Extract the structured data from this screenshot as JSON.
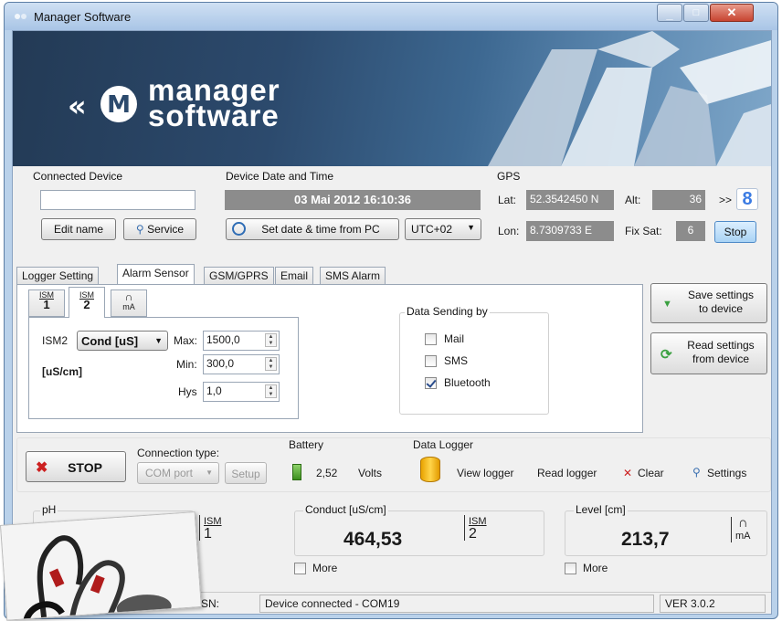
{
  "window": {
    "title": "Manager Software"
  },
  "banner": {
    "logo_line1": "manager",
    "logo_line2": "software"
  },
  "connected_device": {
    "label": "Connected Device",
    "name_value": "",
    "edit_name": "Edit name",
    "service": "Service"
  },
  "device_time": {
    "label": "Device Date and Time",
    "value": "03 Mai 2012   16:10:36",
    "set_button": "Set date & time from PC",
    "timezone": "UTC+02"
  },
  "gps": {
    "label": "GPS",
    "lat_label": "Lat:",
    "lat": "52.3542450 N",
    "alt_label": "Alt:",
    "alt": "36",
    "lon_label": "Lon:",
    "lon": "8.7309733 E",
    "fixsat_label": "Fix Sat:",
    "fixsat": "6",
    "more": ">>",
    "stop": "Stop"
  },
  "tabs": [
    "Logger Setting",
    "Alarm Sensor",
    "GSM/GPRS",
    "Email",
    "SMS Alarm"
  ],
  "subtabs": [
    {
      "top": "ISM",
      "num": "1"
    },
    {
      "top": "ISM",
      "num": "2"
    },
    {
      "top": "∩",
      "num": "mA"
    }
  ],
  "alarm": {
    "sensor_label": "ISM2",
    "sensor_select": "Cond [uS]",
    "unit": "[uS/cm]",
    "max_label": "Max:",
    "max": "1500,0",
    "min_label": "Min:",
    "min": "300,0",
    "hys_label": "Hys",
    "hys": "1,0"
  },
  "data_sending": {
    "label": "Data Sending by",
    "options": [
      {
        "label": "Mail",
        "checked": false
      },
      {
        "label": "SMS",
        "checked": false
      },
      {
        "label": "Bluetooth",
        "checked": true
      }
    ]
  },
  "side_buttons": {
    "save": "Save settings\nto device",
    "read": "Read settings\nfrom device"
  },
  "control": {
    "stop": "STOP",
    "connection_label": "Connection type:",
    "connection_value": "COM port",
    "setup": "Setup",
    "battery_label": "Battery",
    "battery_value": "2,52",
    "battery_unit": "Volts",
    "logger_label": "Data Logger",
    "view_logger": "View logger",
    "read_logger": "Read logger",
    "clear": "Clear",
    "settings": "Settings"
  },
  "readings": {
    "ph_label": "pH",
    "ph_ism_top": "ISM",
    "ph_ism_num": "1",
    "cond_label": "Conduct [uS/cm]",
    "cond_value": "464,53",
    "cond_ism_top": "ISM",
    "cond_ism_num": "2",
    "cond_more": "More",
    "level_label": "Level  [cm]",
    "level_value": "213,7",
    "level_unit": "mA",
    "level_more": "More"
  },
  "status": {
    "sn_label": "SN:",
    "message": "Device connected - COM19",
    "version": "VER 3.0.2"
  },
  "colors": {
    "accent_green": "#3aa040",
    "stop_red": "#cc2020",
    "field_gray": "#8c8c8c",
    "bluetooth_blue": "#2f7de1"
  }
}
